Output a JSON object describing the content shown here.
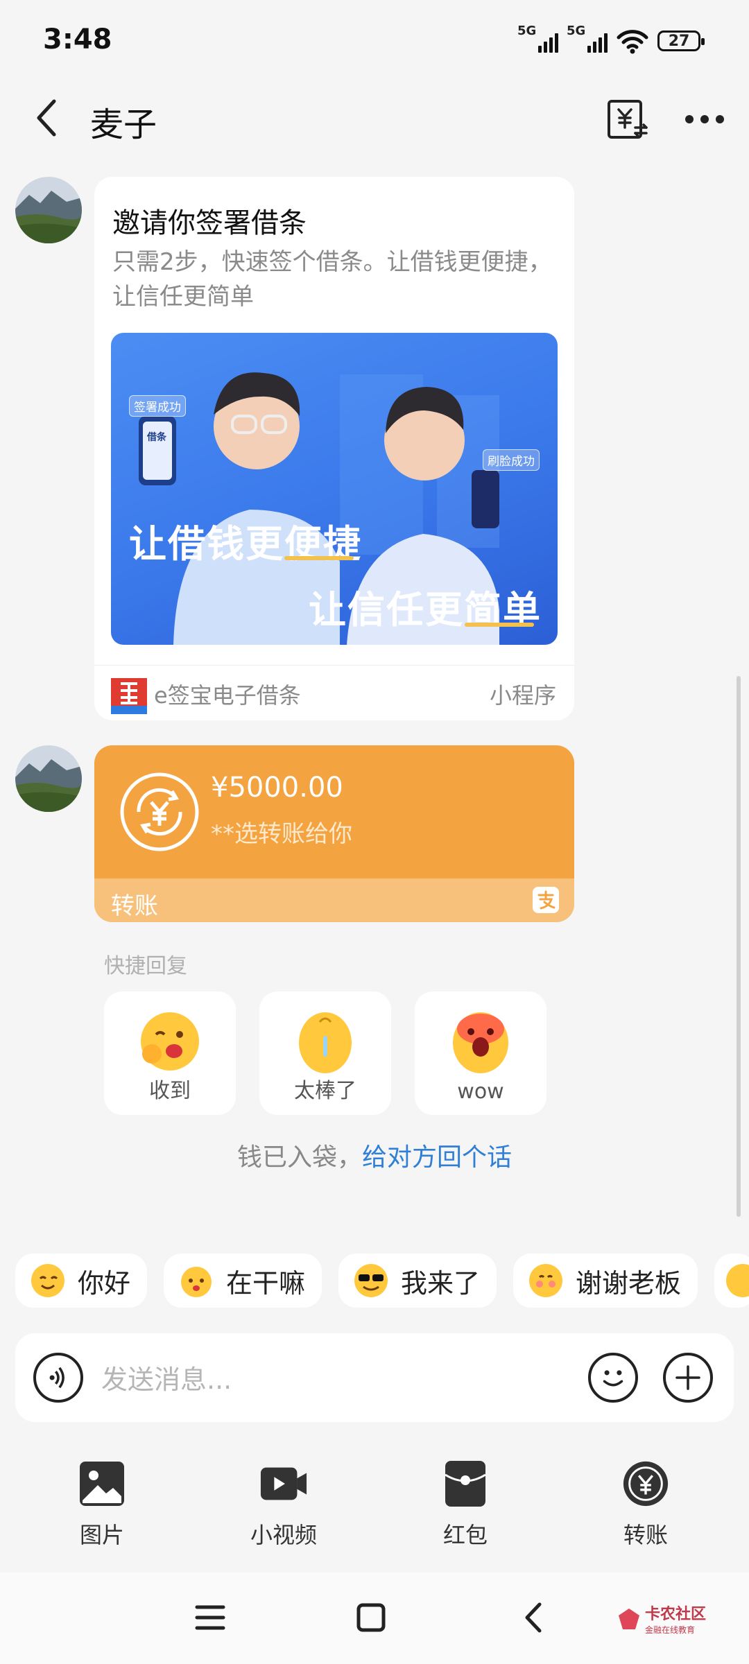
{
  "status_bar": {
    "time": "3:48",
    "network1": "5G",
    "network2": "5G",
    "battery": "27"
  },
  "header": {
    "title": "麦子"
  },
  "invite_card": {
    "title": "邀请你签署借条",
    "desc": "只需2步，快速签个借条。让借钱更便捷，让信任更简单",
    "banner_line1": "让借钱更便捷",
    "banner_line2": "让信任更简单",
    "badge_signed": "签署成功",
    "badge_face": "刷脸成功",
    "phone_text": "借条",
    "mini_name": "e签宝电子借条",
    "mini_type": "小程序"
  },
  "transfer_card": {
    "amount": "¥5000.00",
    "subtitle": "**选转账给你",
    "label": "转账",
    "accent": "#f3a33f"
  },
  "quick_reply": {
    "title": "快捷回复",
    "items": [
      {
        "label": "收到"
      },
      {
        "label": "太棒了"
      },
      {
        "label": "wow"
      }
    ]
  },
  "received_notice": {
    "text": "钱已入袋，",
    "link": "给对方回个话"
  },
  "chips": [
    {
      "label": "你好"
    },
    {
      "label": "在干嘛"
    },
    {
      "label": "我来了"
    },
    {
      "label": "谢谢老板"
    }
  ],
  "input": {
    "placeholder": "发送消息..."
  },
  "tools": [
    {
      "label": "图片",
      "icon": "image-icon"
    },
    {
      "label": "小视频",
      "icon": "video-icon"
    },
    {
      "label": "红包",
      "icon": "red-packet-icon"
    },
    {
      "label": "转账",
      "icon": "transfer-icon"
    }
  ],
  "watermark": {
    "text": "卡农社区",
    "sub": "金融在线教育"
  }
}
